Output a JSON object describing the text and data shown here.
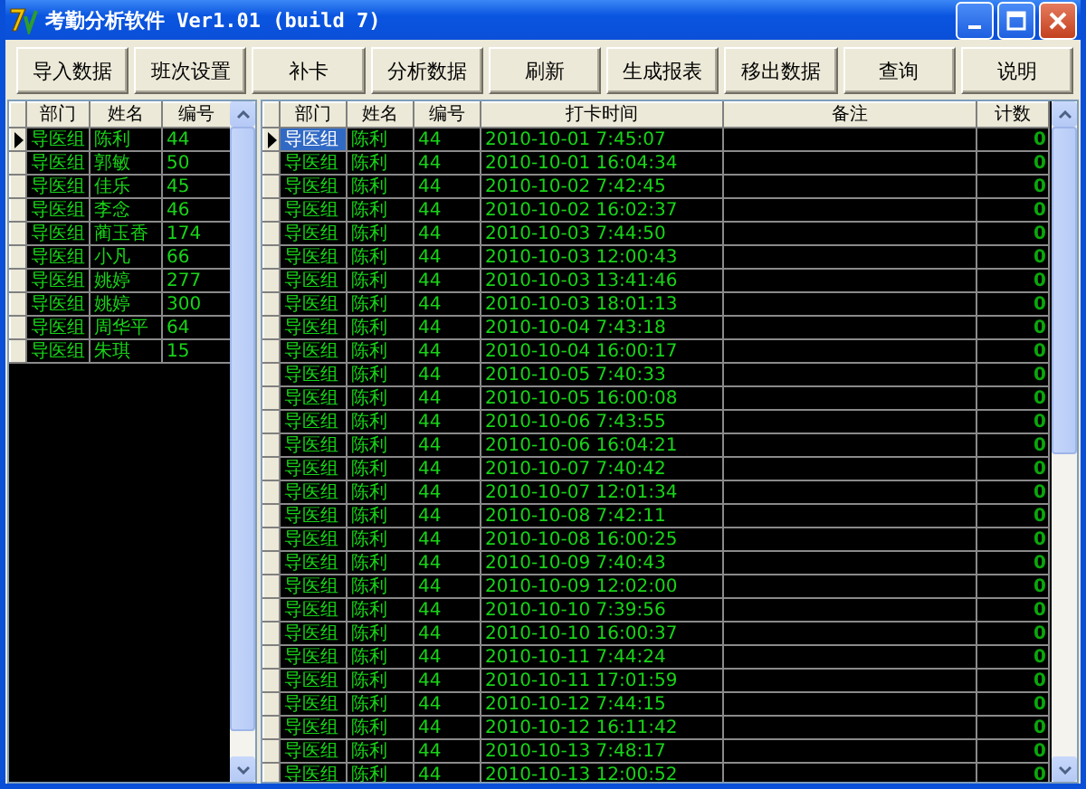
{
  "window": {
    "title": "考勤分析软件 Ver1.01 (build 7)"
  },
  "toolbar": [
    {
      "label": "导入数据"
    },
    {
      "label": "班次设置"
    },
    {
      "label": "补卡"
    },
    {
      "label": "分析数据"
    },
    {
      "label": "刷新"
    },
    {
      "label": "生成报表"
    },
    {
      "label": "移出数据"
    },
    {
      "label": "查询"
    },
    {
      "label": "说明"
    }
  ],
  "employee_table": {
    "columns": [
      "部门",
      "姓名",
      "编号"
    ],
    "rows": [
      {
        "selected": true,
        "cells": [
          "导医组",
          "陈利",
          "44"
        ]
      },
      {
        "selected": false,
        "cells": [
          "导医组",
          "郭敏",
          "50"
        ]
      },
      {
        "selected": false,
        "cells": [
          "导医组",
          "佳乐",
          "45"
        ]
      },
      {
        "selected": false,
        "cells": [
          "导医组",
          "李念",
          "46"
        ]
      },
      {
        "selected": false,
        "cells": [
          "导医组",
          "蔺玉香",
          "174"
        ]
      },
      {
        "selected": false,
        "cells": [
          "导医组",
          "小凡",
          "66"
        ]
      },
      {
        "selected": false,
        "cells": [
          "导医组",
          "姚婷",
          "277"
        ]
      },
      {
        "selected": false,
        "cells": [
          "导医组",
          "姚婷",
          "300"
        ]
      },
      {
        "selected": false,
        "cells": [
          "导医组",
          "周华平",
          "64"
        ]
      },
      {
        "selected": false,
        "cells": [
          "导医组",
          "朱琪",
          "15"
        ]
      }
    ]
  },
  "record_table": {
    "cell_focus": true,
    "columns": [
      "部门",
      "姓名",
      "编号",
      "打卡时间",
      "备注",
      "计数"
    ],
    "rows": [
      {
        "selected": true,
        "cells": [
          "导医组",
          "陈利",
          "44",
          "2010-10-01 7:45:07",
          "",
          "0"
        ]
      },
      {
        "selected": false,
        "cells": [
          "导医组",
          "陈利",
          "44",
          "2010-10-01 16:04:34",
          "",
          "0"
        ]
      },
      {
        "selected": false,
        "cells": [
          "导医组",
          "陈利",
          "44",
          "2010-10-02 7:42:45",
          "",
          "0"
        ]
      },
      {
        "selected": false,
        "cells": [
          "导医组",
          "陈利",
          "44",
          "2010-10-02 16:02:37",
          "",
          "0"
        ]
      },
      {
        "selected": false,
        "cells": [
          "导医组",
          "陈利",
          "44",
          "2010-10-03 7:44:50",
          "",
          "0"
        ]
      },
      {
        "selected": false,
        "cells": [
          "导医组",
          "陈利",
          "44",
          "2010-10-03 12:00:43",
          "",
          "0"
        ]
      },
      {
        "selected": false,
        "cells": [
          "导医组",
          "陈利",
          "44",
          "2010-10-03 13:41:46",
          "",
          "0"
        ]
      },
      {
        "selected": false,
        "cells": [
          "导医组",
          "陈利",
          "44",
          "2010-10-03 18:01:13",
          "",
          "0"
        ]
      },
      {
        "selected": false,
        "cells": [
          "导医组",
          "陈利",
          "44",
          "2010-10-04 7:43:18",
          "",
          "0"
        ]
      },
      {
        "selected": false,
        "cells": [
          "导医组",
          "陈利",
          "44",
          "2010-10-04 16:00:17",
          "",
          "0"
        ]
      },
      {
        "selected": false,
        "cells": [
          "导医组",
          "陈利",
          "44",
          "2010-10-05 7:40:33",
          "",
          "0"
        ]
      },
      {
        "selected": false,
        "cells": [
          "导医组",
          "陈利",
          "44",
          "2010-10-05 16:00:08",
          "",
          "0"
        ]
      },
      {
        "selected": false,
        "cells": [
          "导医组",
          "陈利",
          "44",
          "2010-10-06 7:43:55",
          "",
          "0"
        ]
      },
      {
        "selected": false,
        "cells": [
          "导医组",
          "陈利",
          "44",
          "2010-10-06 16:04:21",
          "",
          "0"
        ]
      },
      {
        "selected": false,
        "cells": [
          "导医组",
          "陈利",
          "44",
          "2010-10-07 7:40:42",
          "",
          "0"
        ]
      },
      {
        "selected": false,
        "cells": [
          "导医组",
          "陈利",
          "44",
          "2010-10-07 12:01:34",
          "",
          "0"
        ]
      },
      {
        "selected": false,
        "cells": [
          "导医组",
          "陈利",
          "44",
          "2010-10-08 7:42:11",
          "",
          "0"
        ]
      },
      {
        "selected": false,
        "cells": [
          "导医组",
          "陈利",
          "44",
          "2010-10-08 16:00:25",
          "",
          "0"
        ]
      },
      {
        "selected": false,
        "cells": [
          "导医组",
          "陈利",
          "44",
          "2010-10-09 7:40:43",
          "",
          "0"
        ]
      },
      {
        "selected": false,
        "cells": [
          "导医组",
          "陈利",
          "44",
          "2010-10-09 12:02:00",
          "",
          "0"
        ]
      },
      {
        "selected": false,
        "cells": [
          "导医组",
          "陈利",
          "44",
          "2010-10-10 7:39:56",
          "",
          "0"
        ]
      },
      {
        "selected": false,
        "cells": [
          "导医组",
          "陈利",
          "44",
          "2010-10-10 16:00:37",
          "",
          "0"
        ]
      },
      {
        "selected": false,
        "cells": [
          "导医组",
          "陈利",
          "44",
          "2010-10-11 7:44:24",
          "",
          "0"
        ]
      },
      {
        "selected": false,
        "cells": [
          "导医组",
          "陈利",
          "44",
          "2010-10-11 17:01:59",
          "",
          "0"
        ]
      },
      {
        "selected": false,
        "cells": [
          "导医组",
          "陈利",
          "44",
          "2010-10-12 7:44:15",
          "",
          "0"
        ]
      },
      {
        "selected": false,
        "cells": [
          "导医组",
          "陈利",
          "44",
          "2010-10-12 16:11:42",
          "",
          "0"
        ]
      },
      {
        "selected": false,
        "cells": [
          "导医组",
          "陈利",
          "44",
          "2010-10-13 7:48:17",
          "",
          "0"
        ]
      },
      {
        "selected": false,
        "cells": [
          "导医组",
          "陈利",
          "44",
          "2010-10-13 12:00:52",
          "",
          "0"
        ]
      }
    ]
  }
}
